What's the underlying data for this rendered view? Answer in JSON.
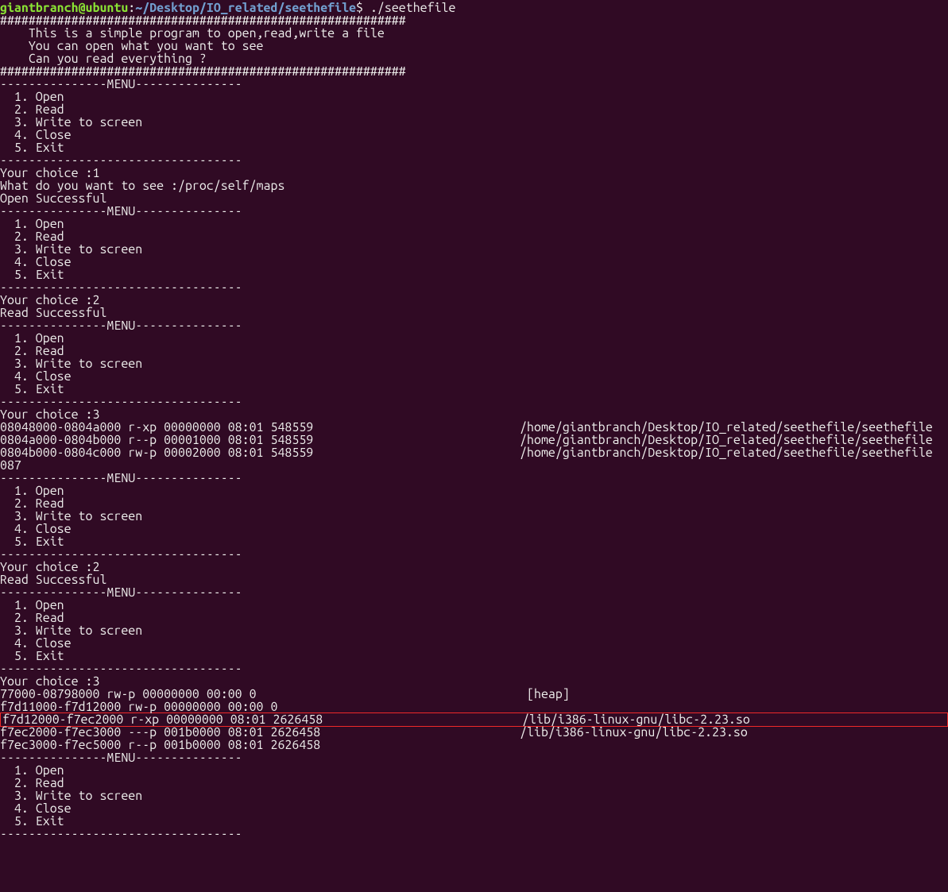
{
  "prompt": {
    "user": "giantbranch",
    "at": "@",
    "host": "ubuntu",
    "colon": ":",
    "path": "~/Desktop/IO_related/seethefile",
    "dollar": "$ ",
    "command": "./seethefile"
  },
  "banner": {
    "hash": "#########################################################",
    "l1": "    This is a simple program to open,read,write a file",
    "l2": "    You can open what you want to see",
    "l3": "    Can you read everything ?"
  },
  "menu": {
    "header": "---------------MENU---------------",
    "footer": "----------------------------------",
    "i1": "  1. Open",
    "i2": "  2. Read",
    "i3": "  3. Write to screen",
    "i4": "  4. Close",
    "i5": "  5. Exit"
  },
  "io": {
    "choice1": "Your choice :1",
    "want": "What do you want to see :/proc/self/maps",
    "openok": "Open Successful",
    "choice2_a": "Your choice :2",
    "readok": "Read Successful",
    "choice3_a": "Your choice :3",
    "maps1_l1": "08048000-0804a000 r-xp 00000000 08:01 548559                             /home/giantbranch/Desktop/IO_related/seethefile/seethefile",
    "maps1_l2": "0804a000-0804b000 r--p 00001000 08:01 548559                             /home/giantbranch/Desktop/IO_related/seethefile/seethefile",
    "maps1_l3": "0804b000-0804c000 rw-p 00002000 08:01 548559                             /home/giantbranch/Desktop/IO_related/seethefile/seethefile",
    "maps1_l4": "087",
    "choice2_b": "Your choice :2",
    "choice3_b": "Your choice :3",
    "maps2_l1": "77000-08798000 rw-p 00000000 00:00 0                                      [heap]",
    "maps2_l2": "f7d11000-f7d12000 rw-p 00000000 00:00 0 ",
    "maps2_l3_hl": "f7d12000-f7ec2000 r-xp 00000000 08:01 2626458                            /lib/i386-linux-gnu/libc-2.23.so",
    "maps2_l4": "f7ec2000-f7ec3000 ---p 001b0000 08:01 2626458                            /lib/i386-linux-gnu/libc-2.23.so",
    "maps2_l5": "f7ec3000-f7ec5000 r--p 001b0000 08:01 2626458"
  }
}
